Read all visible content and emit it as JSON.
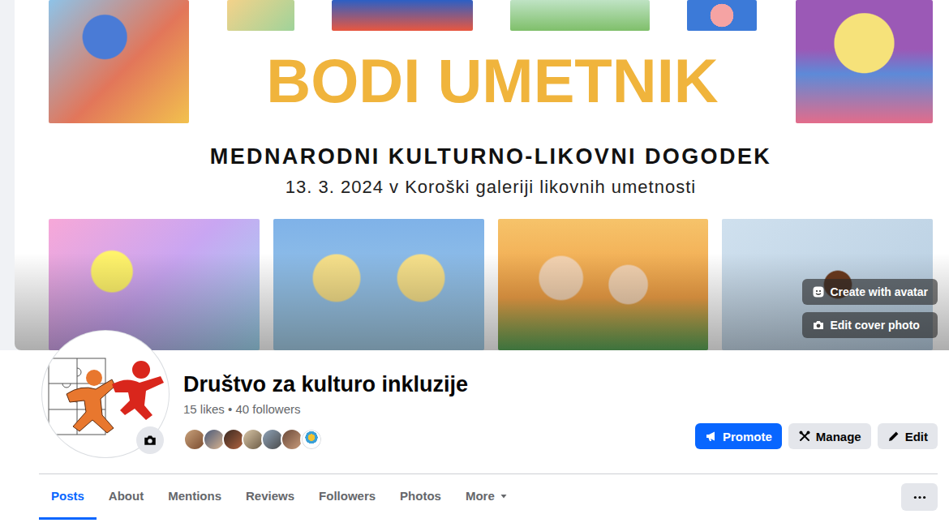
{
  "cover": {
    "title": "BODI UMETNIK",
    "subtitle": "MEDNARODNI KULTURNO-LIKOVNI DOGODEK",
    "date_line": "13. 3. 2024 v Koroški galeriji likovnih umetnosti",
    "actions": [
      {
        "label": "Create with avatar"
      },
      {
        "label": "Edit cover photo"
      }
    ]
  },
  "page": {
    "name": "Društvo za kulturo inkluzije",
    "stats": "15 likes • 40 followers"
  },
  "actions": [
    {
      "label": "Promote",
      "kind": "primary"
    },
    {
      "label": "Manage",
      "kind": "secondary"
    },
    {
      "label": "Edit",
      "kind": "secondary"
    }
  ],
  "tabs": [
    {
      "label": "Posts",
      "selected": true,
      "kind": "link"
    },
    {
      "label": "About",
      "selected": false,
      "kind": "link"
    },
    {
      "label": "Mentions",
      "selected": false,
      "kind": "link"
    },
    {
      "label": "Reviews",
      "selected": false,
      "kind": "link"
    },
    {
      "label": "Followers",
      "selected": false,
      "kind": "link"
    },
    {
      "label": "Photos",
      "selected": false,
      "kind": "link"
    },
    {
      "label": "More",
      "selected": false,
      "kind": "dropdown"
    }
  ]
}
